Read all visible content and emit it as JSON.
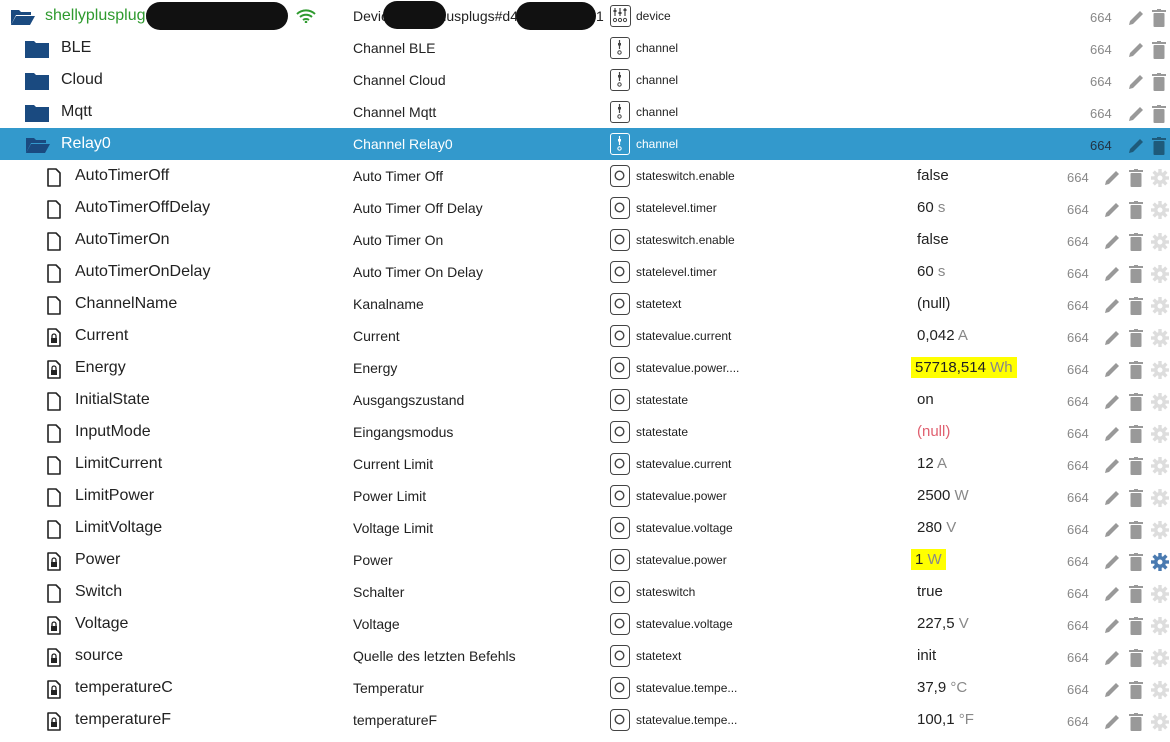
{
  "device": {
    "name": "shellyplusplugs#d4d4",
    "description": "Device shellyplusplugs#d4",
    "desc_suffix": "1",
    "role": "device",
    "acl": "664",
    "name_color": "#2e9a2e"
  },
  "channels": [
    {
      "name": "BLE",
      "description": "Channel BLE",
      "role": "channel",
      "acl": "664"
    },
    {
      "name": "Cloud",
      "description": "Channel Cloud",
      "role": "channel",
      "acl": "664"
    },
    {
      "name": "Mqtt",
      "description": "Channel Mqtt",
      "role": "channel",
      "acl": "664"
    },
    {
      "name": "Relay0",
      "description": "Channel Relay0",
      "role": "channel",
      "acl": "664",
      "selected": true
    }
  ],
  "states": [
    {
      "name": "AutoTimerOff",
      "description": "Auto Timer Off",
      "role": "stateswitch.enable",
      "value": "false",
      "unit": "",
      "acl": "664",
      "locked": false
    },
    {
      "name": "AutoTimerOffDelay",
      "description": "Auto Timer Off Delay",
      "role": "statelevel.timer",
      "value": "60",
      "unit": "s",
      "acl": "664",
      "locked": false
    },
    {
      "name": "AutoTimerOn",
      "description": "Auto Timer On",
      "role": "stateswitch.enable",
      "value": "false",
      "unit": "",
      "acl": "664",
      "locked": false
    },
    {
      "name": "AutoTimerOnDelay",
      "description": "Auto Timer On Delay",
      "role": "statelevel.timer",
      "value": "60",
      "unit": "s",
      "acl": "664",
      "locked": false
    },
    {
      "name": "ChannelName",
      "description": "Kanalname",
      "role": "statetext",
      "value": "(null)",
      "unit": "",
      "acl": "664",
      "locked": false
    },
    {
      "name": "Current",
      "description": "Current",
      "role": "statevalue.current",
      "value": "0,042",
      "unit": "A",
      "acl": "664",
      "locked": true
    },
    {
      "name": "Energy",
      "description": "Energy",
      "role": "statevalue.power....",
      "value": "57718,514",
      "unit": "Wh",
      "acl": "664",
      "locked": true,
      "highlight": true
    },
    {
      "name": "InitialState",
      "description": "Ausgangszustand",
      "role": "statestate",
      "value": "on",
      "unit": "",
      "acl": "664",
      "locked": false
    },
    {
      "name": "InputMode",
      "description": "Eingangsmodus",
      "role": "statestate",
      "value": "(null)",
      "unit": "",
      "acl": "664",
      "locked": false,
      "null_red": true
    },
    {
      "name": "LimitCurrent",
      "description": "Current Limit",
      "role": "statevalue.current",
      "value": "12",
      "unit": "A",
      "acl": "664",
      "locked": false
    },
    {
      "name": "LimitPower",
      "description": "Power Limit",
      "role": "statevalue.power",
      "value": "2500",
      "unit": "W",
      "acl": "664",
      "locked": false
    },
    {
      "name": "LimitVoltage",
      "description": "Voltage Limit",
      "role": "statevalue.voltage",
      "value": "280",
      "unit": "V",
      "acl": "664",
      "locked": false
    },
    {
      "name": "Power",
      "description": "Power",
      "role": "statevalue.power",
      "value": "1",
      "unit": "W",
      "acl": "664",
      "locked": true,
      "highlight": true,
      "gear_active": true
    },
    {
      "name": "Switch",
      "description": "Schalter",
      "role": "stateswitch",
      "value": "true",
      "unit": "",
      "acl": "664",
      "locked": false
    },
    {
      "name": "Voltage",
      "description": "Voltage",
      "role": "statevalue.voltage",
      "value": "227,5",
      "unit": "V",
      "acl": "664",
      "locked": true
    },
    {
      "name": "source",
      "description": "Quelle des letzten Befehls",
      "role": "statetext",
      "value": "init",
      "unit": "",
      "acl": "664",
      "locked": true
    },
    {
      "name": "temperatureC",
      "description": "Temperatur",
      "role": "statevalue.tempe...",
      "value": "37,9",
      "unit": "°C",
      "acl": "664",
      "locked": true
    },
    {
      "name": "temperatureF",
      "description": "temperatureF",
      "role": "statevalue.tempe...",
      "value": "100,1",
      "unit": "°F",
      "acl": "664",
      "locked": true
    }
  ],
  "colors": {
    "selected_row": "#3399cc",
    "folder": "#1a4a80",
    "highlight": "#ffff00",
    "gear_active": "#4a7ab0",
    "icon_gray": "#999999"
  }
}
